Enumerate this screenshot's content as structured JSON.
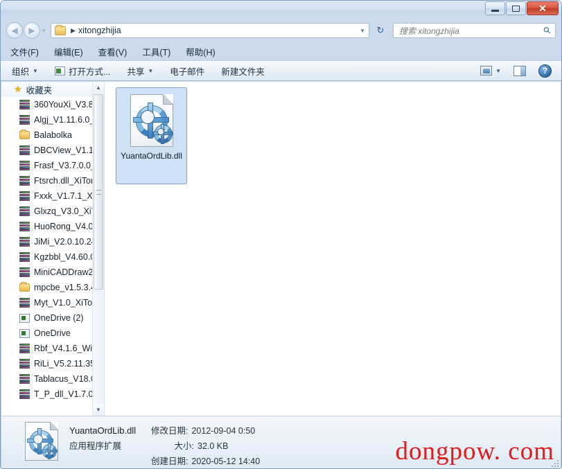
{
  "window": {
    "controls": {
      "minimize": "—",
      "maximize": "□",
      "close": "✕"
    }
  },
  "address": {
    "back_icon": "back-arrow-icon",
    "forward_icon": "forward-arrow-icon",
    "separator": "▾",
    "folder_icon": "folder-icon",
    "crumb_arrow": "▶",
    "path": "xitongzhijia",
    "dropdown": "▼",
    "refresh_icon": "↻"
  },
  "search": {
    "placeholder": "搜索 xitongzhijia",
    "icon": "search-icon"
  },
  "menu": {
    "items": [
      {
        "label": "文件(F)"
      },
      {
        "label": "编辑(E)"
      },
      {
        "label": "查看(V)"
      },
      {
        "label": "工具(T)"
      },
      {
        "label": "帮助(H)"
      }
    ]
  },
  "toolbar": {
    "organize": "组织",
    "open_with": "打开方式...",
    "share": "共享",
    "email": "电子邮件",
    "new_folder": "新建文件夹",
    "caret": "▼",
    "view_icon": "view-layout-icon",
    "view_caret": "▼",
    "preview_pane_icon": "preview-pane-icon",
    "help_icon": "?"
  },
  "sidebar": {
    "header": {
      "label": "收藏夹",
      "icon": "star-icon"
    },
    "items": [
      {
        "label": "360YouXi_V3.8.",
        "icon": "archive-icon"
      },
      {
        "label": "Algj_V1.11.6.0_X",
        "icon": "archive-icon"
      },
      {
        "label": "Balabolka",
        "icon": "folder-icon"
      },
      {
        "label": "DBCView_V1.1_",
        "icon": "archive-icon"
      },
      {
        "label": "Frasf_V3.7.0.0_X",
        "icon": "archive-icon"
      },
      {
        "label": "Ftsrch.dll_XiTon",
        "icon": "archive-icon"
      },
      {
        "label": "Fxxk_V1.7.1_XiT",
        "icon": "archive-icon"
      },
      {
        "label": "Glxzq_V3.0_XiT",
        "icon": "archive-icon"
      },
      {
        "label": "HuoRong_V4.0.",
        "icon": "archive-icon"
      },
      {
        "label": "JiMi_V2.0.10.24",
        "icon": "archive-icon"
      },
      {
        "label": "Kgzbbl_V4.60.0",
        "icon": "archive-icon"
      },
      {
        "label": "MiniCADDraw2",
        "icon": "archive-icon"
      },
      {
        "label": "mpcbe_v1.5.3.4",
        "icon": "folder-icon"
      },
      {
        "label": "Myt_V1.0_XiTon",
        "icon": "archive-icon"
      },
      {
        "label": "OneDrive (2)",
        "icon": "onedrive-icon"
      },
      {
        "label": "OneDrive",
        "icon": "onedrive-icon"
      },
      {
        "label": "Rbf_V4.1.6_Win",
        "icon": "archive-icon"
      },
      {
        "label": "RiLi_V5.2.11.354",
        "icon": "archive-icon"
      },
      {
        "label": "Tablacus_V18.0",
        "icon": "archive-icon"
      },
      {
        "label": "T_P_dll_V1.7.0",
        "icon": "archive-icon"
      }
    ],
    "scroll_up": "▲",
    "scroll_down": "▼"
  },
  "files": [
    {
      "name": "YuantaOrdLib.dll",
      "icon": "dll-gear-icon",
      "selected": true
    }
  ],
  "status": {
    "icon": "dll-gear-icon",
    "file_name": "YuantaOrdLib.dll",
    "file_type": "应用程序扩展",
    "modified_key": "修改日期:",
    "modified_value": "2012-09-04 0:50",
    "size_key": "大小:",
    "size_value": "32.0 KB",
    "created_key": "创建日期:",
    "created_value": "2020-05-12 14:40"
  },
  "watermark": {
    "text": "dongpow. com",
    "color": "#e01b1b"
  }
}
